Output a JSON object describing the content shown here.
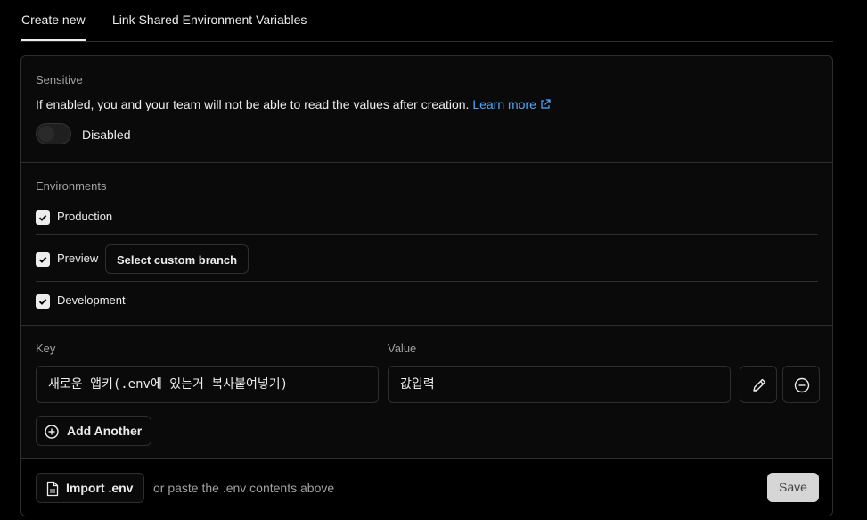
{
  "tabs": [
    {
      "label": "Create new",
      "active": true
    },
    {
      "label": "Link Shared Environment Variables",
      "active": false
    }
  ],
  "sensitive": {
    "heading": "Sensitive",
    "description": "If enabled, you and your team will not be able to read the values after creation.",
    "learn_more": "Learn more",
    "toggle_state": "Disabled"
  },
  "environments": {
    "heading": "Environments",
    "items": [
      {
        "label": "Production",
        "checked": true
      },
      {
        "label": "Preview",
        "checked": true
      },
      {
        "label": "Development",
        "checked": true
      }
    ],
    "branch_button": "Select custom branch"
  },
  "variables": {
    "key_label": "Key",
    "value_label": "Value",
    "key_value": "새로운 앱키(.env에 있는거 복사붙여넣기)",
    "value_value": "값입력",
    "add_another": "Add Another"
  },
  "footer": {
    "import_label": "Import .env",
    "hint": "or paste the .env contents above",
    "save_label": "Save"
  },
  "colors": {
    "background": "#000000",
    "card": "#0a0a0a",
    "border": "#2e2e2e",
    "link": "#52a8ff",
    "save_button": "#d6d6d6"
  }
}
